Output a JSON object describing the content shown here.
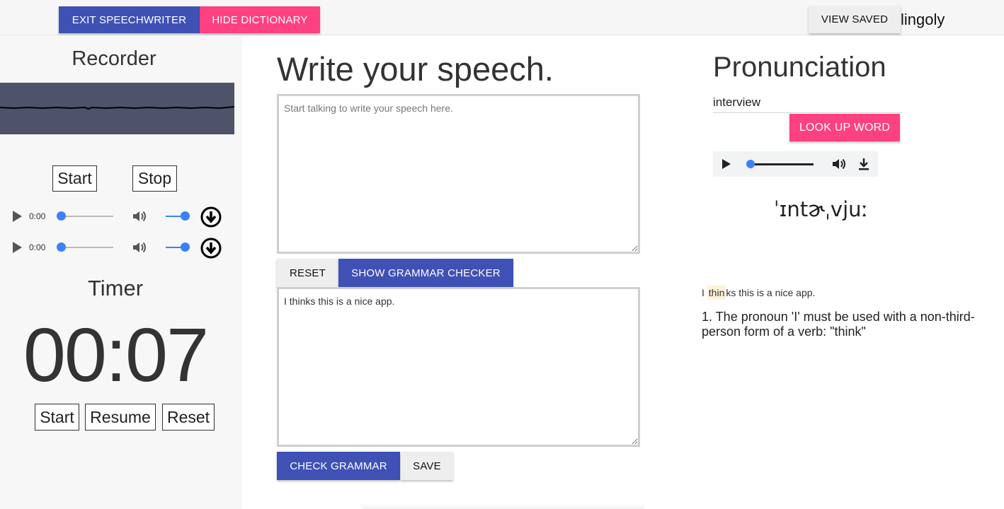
{
  "topbar": {
    "exit_label": "EXIT SPEECHWRITER",
    "hide_label": "HIDE DICTIONARY",
    "view_saved_label": "VIEW SAVED",
    "brand": "lingoly"
  },
  "recorder": {
    "title": "Recorder",
    "start_label": "Start",
    "stop_label": "Stop",
    "players": [
      {
        "time": "0:00"
      },
      {
        "time": "0:00"
      }
    ]
  },
  "timer": {
    "title": "Timer",
    "value": "00:07",
    "start_label": "Start",
    "resume_label": "Resume",
    "reset_label": "Reset"
  },
  "editor": {
    "title": "Write your speech.",
    "speech_placeholder": "Start talking to write your speech here.",
    "speech_value": "",
    "reset_label": "RESET",
    "show_gc_label": "SHOW GRAMMAR CHECKER",
    "grammar_value": "I thinks this is a nice app.",
    "check_label": "CHECK GRAMMAR",
    "save_label": "SAVE"
  },
  "pronunciation": {
    "title": "Pronunciation",
    "word": "interview",
    "lookup_label": "LOOK UP WORD",
    "ipa": "ˈɪntɚˌvjuː"
  },
  "grammar_result": {
    "sentence_before": "I ",
    "sentence_highlight": "thin",
    "sentence_after": "ks this is a nice app.",
    "suggestion": "1. The pronoun 'I' must be used with a non-third-person form of a verb: \"think\""
  },
  "colors": {
    "primary": "#3f51b5",
    "accent": "#ff4081",
    "waveform_bg": "#4e5369"
  }
}
